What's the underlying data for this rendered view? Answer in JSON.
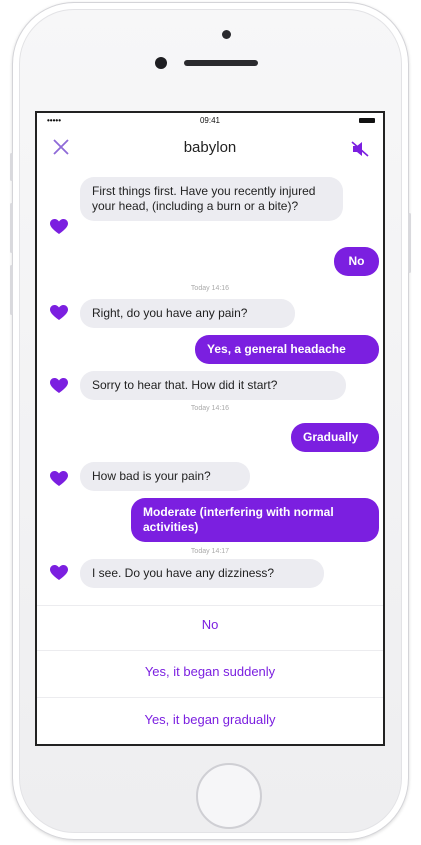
{
  "status_bar": {
    "signal": "•••••",
    "time": "09:41"
  },
  "nav": {
    "title": "babylon",
    "close_icon": "close-icon",
    "mute_icon": "speaker-muted-icon",
    "accent": "#8e6ad8"
  },
  "colors": {
    "brand_purple": "#7b1fe0",
    "bot_bubble": "#ececf1"
  },
  "messages": [
    {
      "from": "bot",
      "text": "First things first. Have you recently injured your head, (including a burn or a bite)?"
    },
    {
      "from": "user",
      "text": "No"
    },
    {
      "from": "timestamp",
      "text": "Today 14:16"
    },
    {
      "from": "bot",
      "text": "Right, do you have any pain?"
    },
    {
      "from": "user",
      "text": "Yes, a general headache"
    },
    {
      "from": "bot",
      "text": "Sorry to hear that. How did it start?"
    },
    {
      "from": "timestamp",
      "text": "Today 14:16"
    },
    {
      "from": "user",
      "text": "Gradually"
    },
    {
      "from": "bot",
      "text": "How bad is your pain?"
    },
    {
      "from": "user",
      "text": "Moderate (interfering with normal activities)"
    },
    {
      "from": "timestamp",
      "text": "Today 14:17"
    },
    {
      "from": "bot",
      "text": "I see. Do you have any dizziness?"
    }
  ],
  "options": [
    {
      "label": "No"
    },
    {
      "label": "Yes, it began suddenly"
    },
    {
      "label": "Yes, it began gradually"
    }
  ]
}
